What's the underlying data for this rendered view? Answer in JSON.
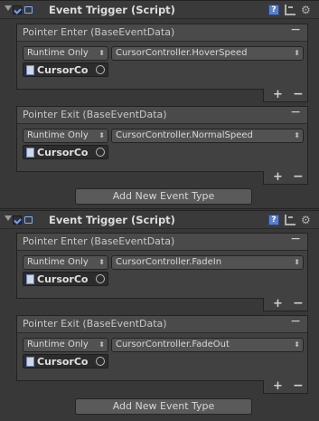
{
  "components": [
    {
      "title": "Event Trigger (Script)",
      "events": [
        {
          "header": "Pointer Enter (BaseEventData)",
          "runtime": "Runtime Only",
          "function": "CursorController.HoverSpeed",
          "object": "CursorCo"
        },
        {
          "header": "Pointer Exit (BaseEventData)",
          "runtime": "Runtime Only",
          "function": "CursorController.NormalSpeed",
          "object": "CursorCo"
        }
      ],
      "add_button": "Add New Event Type"
    },
    {
      "title": "Event Trigger (Script)",
      "events": [
        {
          "header": "Pointer Enter (BaseEventData)",
          "runtime": "Runtime Only",
          "function": "CursorController.FadeIn",
          "object": "CursorCo"
        },
        {
          "header": "Pointer Exit (BaseEventData)",
          "runtime": "Runtime Only",
          "function": "CursorController.FadeOut",
          "object": "CursorCo"
        }
      ],
      "add_button": "Add New Event Type"
    }
  ],
  "icons": {
    "foldout": "foldout-arrow-icon",
    "enable": "checkbox-icon",
    "script": "script-icon",
    "help": "help-icon",
    "preset": "preset-icon",
    "settings": "gear-icon",
    "object": "csharp-script-icon",
    "picker": "object-picker-icon"
  },
  "colors": {
    "panel": "#383838",
    "header": "#3a3a3a",
    "event_box": "#414141",
    "accent": "#5b7fc9"
  }
}
